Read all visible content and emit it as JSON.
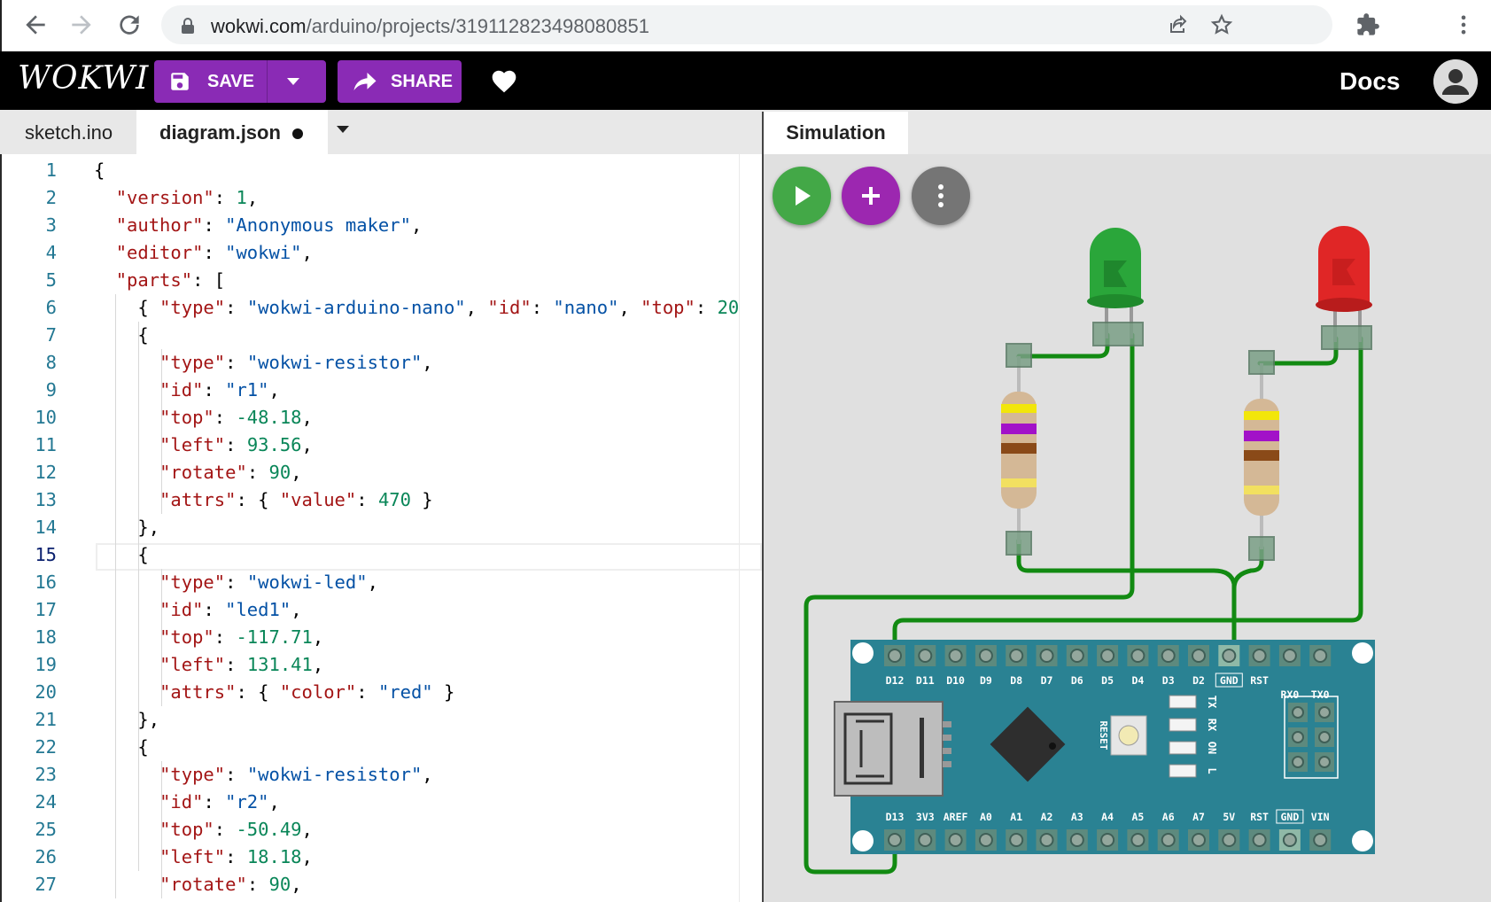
{
  "browser": {
    "url_host": "wokwi.com",
    "url_path": "/arduino/projects/319112823498080851"
  },
  "app": {
    "logo": "WOKWI",
    "save_label": "SAVE",
    "share_label": "SHARE",
    "docs_label": "Docs"
  },
  "editor_tabs": [
    {
      "label": "sketch.ino",
      "active": false
    },
    {
      "label": "diagram.json",
      "active": true,
      "modified": true
    }
  ],
  "sim_tab": "Simulation",
  "active_line": 15,
  "code_lines": [
    "{",
    "  \"version\": 1,",
    "  \"author\": \"Anonymous maker\",",
    "  \"editor\": \"wokwi\",",
    "  \"parts\": [",
    "    { \"type\": \"wokwi-arduino-nano\", \"id\": \"nano\", \"top\": 20",
    "    {",
    "      \"type\": \"wokwi-resistor\",",
    "      \"id\": \"r1\",",
    "      \"top\": -48.18,",
    "      \"left\": 93.56,",
    "      \"rotate\": 90,",
    "      \"attrs\": { \"value\": 470 }",
    "    },",
    "    {",
    "      \"type\": \"wokwi-led\",",
    "      \"id\": \"led1\",",
    "      \"top\": -117.71,",
    "      \"left\": 131.41,",
    "      \"attrs\": { \"color\": \"red\" }",
    "    },",
    "    {",
    "      \"type\": \"wokwi-resistor\",",
    "      \"id\": \"r2\",",
    "      \"top\": -50.49,",
    "      \"left\": 18.18,",
    "      \"rotate\": 90,"
  ],
  "board": {
    "top_pins": [
      "D12",
      "D11",
      "D10",
      "D9",
      "D8",
      "D7",
      "D6",
      "D5",
      "D4",
      "D3",
      "D2",
      "GND",
      "RST",
      "RX0",
      "TX0"
    ],
    "bottom_pins": [
      "D13",
      "3V3",
      "AREF",
      "A0",
      "A1",
      "A2",
      "A3",
      "A4",
      "A5",
      "A6",
      "A7",
      "5V",
      "RST",
      "GND",
      "VIN"
    ],
    "reset_label": "RESET",
    "led_labels": [
      "TX",
      "RX",
      "ON",
      "L"
    ]
  },
  "colors": {
    "accent": "#8a2bb5",
    "wire": "#128a12",
    "board": "#2a8293",
    "led_green": "#2aa63a",
    "led_red": "#e02626",
    "run_button": "#43a847",
    "add_button": "#9c27b0",
    "menu_button": "#757575"
  },
  "icons": [
    "back-icon",
    "forward-icon",
    "reload-icon",
    "lock-icon",
    "share-page-icon",
    "star-icon",
    "extensions-icon",
    "more-vert-icon",
    "save-icon",
    "chevron-down-icon",
    "share-arrow-icon",
    "heart-icon",
    "account-icon",
    "play-icon",
    "add-icon",
    "more-icon"
  ]
}
